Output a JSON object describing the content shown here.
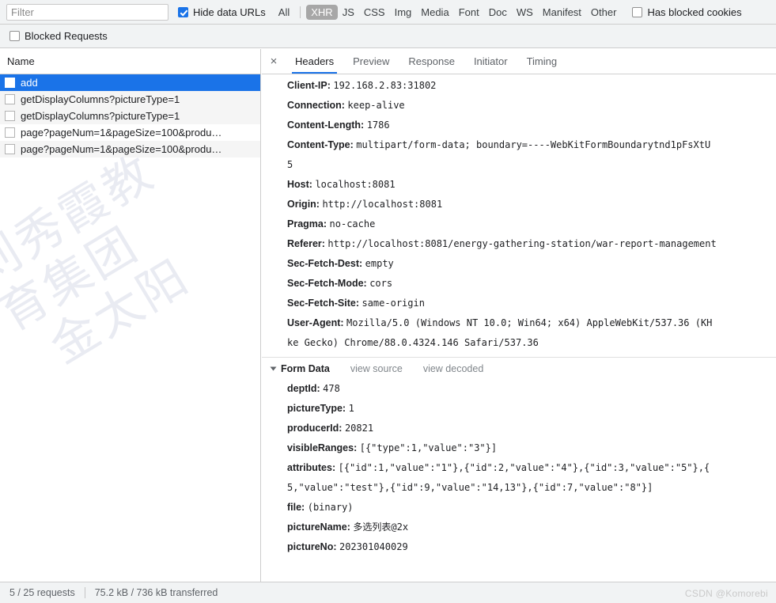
{
  "filter_bar": {
    "filter_placeholder": "Filter",
    "hide_data_urls": {
      "label": "Hide data URLs",
      "checked": true
    },
    "resource_types": [
      {
        "label": "All",
        "active": false
      },
      {
        "label": "XHR",
        "active": true
      },
      {
        "label": "JS",
        "active": false
      },
      {
        "label": "CSS",
        "active": false
      },
      {
        "label": "Img",
        "active": false
      },
      {
        "label": "Media",
        "active": false
      },
      {
        "label": "Font",
        "active": false
      },
      {
        "label": "Doc",
        "active": false
      },
      {
        "label": "WS",
        "active": false
      },
      {
        "label": "Manifest",
        "active": false
      },
      {
        "label": "Other",
        "active": false
      }
    ],
    "has_blocked_cookies": {
      "label": "Has blocked cookies",
      "checked": false
    },
    "blocked_requests": {
      "label": "Blocked Requests",
      "checked": false
    }
  },
  "request_list": {
    "column_header": "Name",
    "rows": [
      {
        "name": "add",
        "selected": true
      },
      {
        "name": "getDisplayColumns?pictureType=1",
        "selected": false
      },
      {
        "name": "getDisplayColumns?pictureType=1",
        "selected": false
      },
      {
        "name": "page?pageNum=1&pageSize=100&produ…",
        "selected": false
      },
      {
        "name": "page?pageNum=1&pageSize=100&produ…",
        "selected": false
      }
    ],
    "watermark_line1": "刘秀霞教育集团",
    "watermark_line2": "金太阳"
  },
  "detail": {
    "close_icon": "×",
    "tabs": [
      {
        "label": "Headers",
        "active": true
      },
      {
        "label": "Preview",
        "active": false
      },
      {
        "label": "Response",
        "active": false
      },
      {
        "label": "Initiator",
        "active": false
      },
      {
        "label": "Timing",
        "active": false
      }
    ],
    "request_headers": [
      {
        "name": "Client-IP:",
        "value": "192.168.2.83:31802"
      },
      {
        "name": "Connection:",
        "value": "keep-alive"
      },
      {
        "name": "Content-Length:",
        "value": "1786"
      },
      {
        "name": "Content-Type:",
        "value": "multipart/form-data; boundary=----WebKitFormBoundarytnd1pFsXtU",
        "continuation": "5"
      },
      {
        "name": "Host:",
        "value": "localhost:8081"
      },
      {
        "name": "Origin:",
        "value": "http://localhost:8081"
      },
      {
        "name": "Pragma:",
        "value": "no-cache"
      },
      {
        "name": "Referer:",
        "value": "http://localhost:8081/energy-gathering-station/war-report-management"
      },
      {
        "name": "Sec-Fetch-Dest:",
        "value": "empty"
      },
      {
        "name": "Sec-Fetch-Mode:",
        "value": "cors"
      },
      {
        "name": "Sec-Fetch-Site:",
        "value": "same-origin"
      },
      {
        "name": "User-Agent:",
        "value": "Mozilla/5.0 (Windows NT 10.0; Win64; x64) AppleWebKit/537.36 (KH",
        "continuation": "ke Gecko) Chrome/88.0.4324.146 Safari/537.36"
      }
    ],
    "form_data_section": {
      "title": "Form Data",
      "view_source_label": "view source",
      "view_decoded_label": "view decoded"
    },
    "form_data": [
      {
        "name": "deptId:",
        "value": "478"
      },
      {
        "name": "pictureType:",
        "value": "1"
      },
      {
        "name": "producerId:",
        "value": "20821"
      },
      {
        "name": "visibleRanges:",
        "value": "[{\"type\":1,\"value\":\"3\"}]"
      },
      {
        "name": "attributes:",
        "value": "[{\"id\":1,\"value\":\"1\"},{\"id\":2,\"value\":\"4\"},{\"id\":3,\"value\":\"5\"},{",
        "continuation": "5,\"value\":\"test\"},{\"id\":9,\"value\":\"14,13\"},{\"id\":7,\"value\":\"8\"}]"
      },
      {
        "name": "file:",
        "value": "(binary)"
      },
      {
        "name": "pictureName:",
        "value": "多选列表@2x"
      },
      {
        "name": "pictureNo:",
        "value": "202301040029"
      }
    ]
  },
  "status_bar": {
    "requests": "5 / 25 requests",
    "transferred": "75.2 kB / 736 kB transferred",
    "watermark": "CSDN @Komorebi"
  },
  "colors": {
    "accent": "#1a73e8",
    "toolbar_bg": "#f1f3f4",
    "selected_row": "#1a73e8",
    "active_type_chip": "#a7a7a7"
  }
}
